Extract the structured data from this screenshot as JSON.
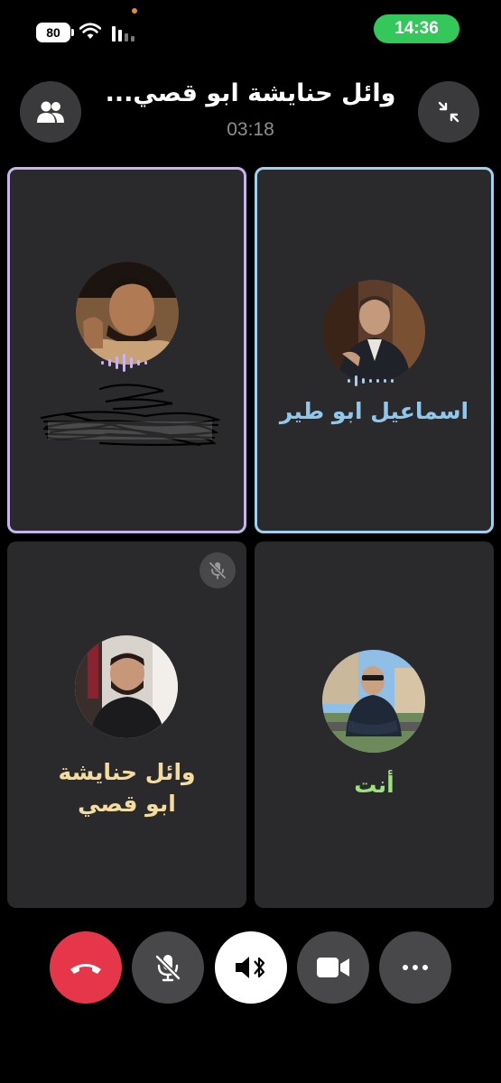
{
  "status_bar": {
    "battery": "80",
    "time": "14:36"
  },
  "header": {
    "title": "وائل حنايشة ابو قصي...",
    "timer": "03:18"
  },
  "participants": [
    {
      "name": "",
      "speaking": true,
      "ring_color": "#c8b3f0",
      "name_redacted": true
    },
    {
      "name": "اسماعيل ابو طير",
      "speaking": true,
      "ring_color": "#9fd0f0",
      "name_color": "#8fc8ec"
    },
    {
      "name_line1": "وائل حنايشة",
      "name_line2": "ابو قصي",
      "muted": true,
      "name_color": "#f3dca0"
    },
    {
      "name": "أنت",
      "name_color": "#9be37c"
    }
  ],
  "controls": {
    "end_call_color": "#e5364a",
    "mic_state": "muted",
    "speaker_mode": "bluetooth",
    "video_state": "off"
  },
  "icons": [
    "battery-icon",
    "wifi-icon",
    "cellular-icon",
    "participants-icon",
    "minimize-icon",
    "mic-off-icon",
    "end-call-icon",
    "bluetooth-speaker-icon",
    "video-camera-icon",
    "more-icon"
  ]
}
